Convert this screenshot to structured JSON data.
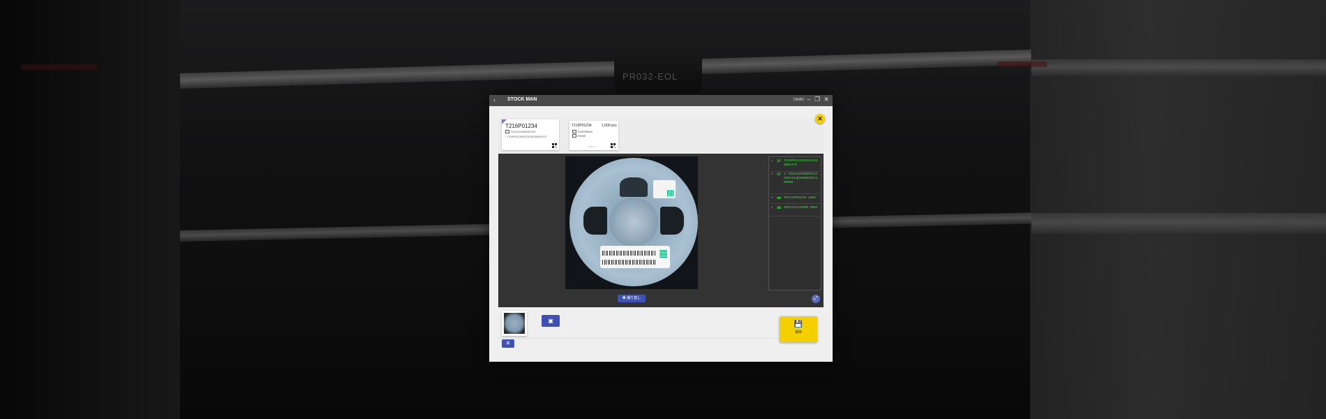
{
  "background": {
    "machine_label": "PR032-EOL"
  },
  "titlebar": {
    "back_icon": "chevron-left-icon",
    "title": "STOCK MAN",
    "user": "DEMO",
    "minimize": "–",
    "maximize": "❐",
    "close": "✕"
  },
  "dialog": {
    "close_label": "✕",
    "cards": [
      {
        "part_number": "T216P01234",
        "lot": "RGU210930000781",
        "code": "T216P01234R22120030001470"
      },
      {
        "part_number": "T210P01234",
        "quantity": "1,000 pcs",
        "lot": "S22P99000",
        "date": "00600",
        "footer": "Box 0 1"
      }
    ],
    "scans": [
      {
        "index": "1",
        "type": "37",
        "value": "T216P01234R22120030001470"
      },
      {
        "index": "2",
        "type": "37",
        "value": "3 +RGU21093000P12180D1234Q10000Z251100000"
      },
      {
        "index": "3",
        "type": "0B",
        "value": "39T216P01234 1000"
      },
      {
        "index": "4",
        "type": "0B",
        "value": "2RZ1222118000 0002"
      }
    ],
    "retake_label": "◉ 撮り直し",
    "fullscreen_icon": "⤢",
    "add_image_icon": "▣",
    "small_button_icon": "⧉",
    "save_icon": "💾",
    "save_label": "保存"
  },
  "colors": {
    "accent": "#3f51b5",
    "save": "#f5d000",
    "scan_text": "#2fe82f"
  }
}
